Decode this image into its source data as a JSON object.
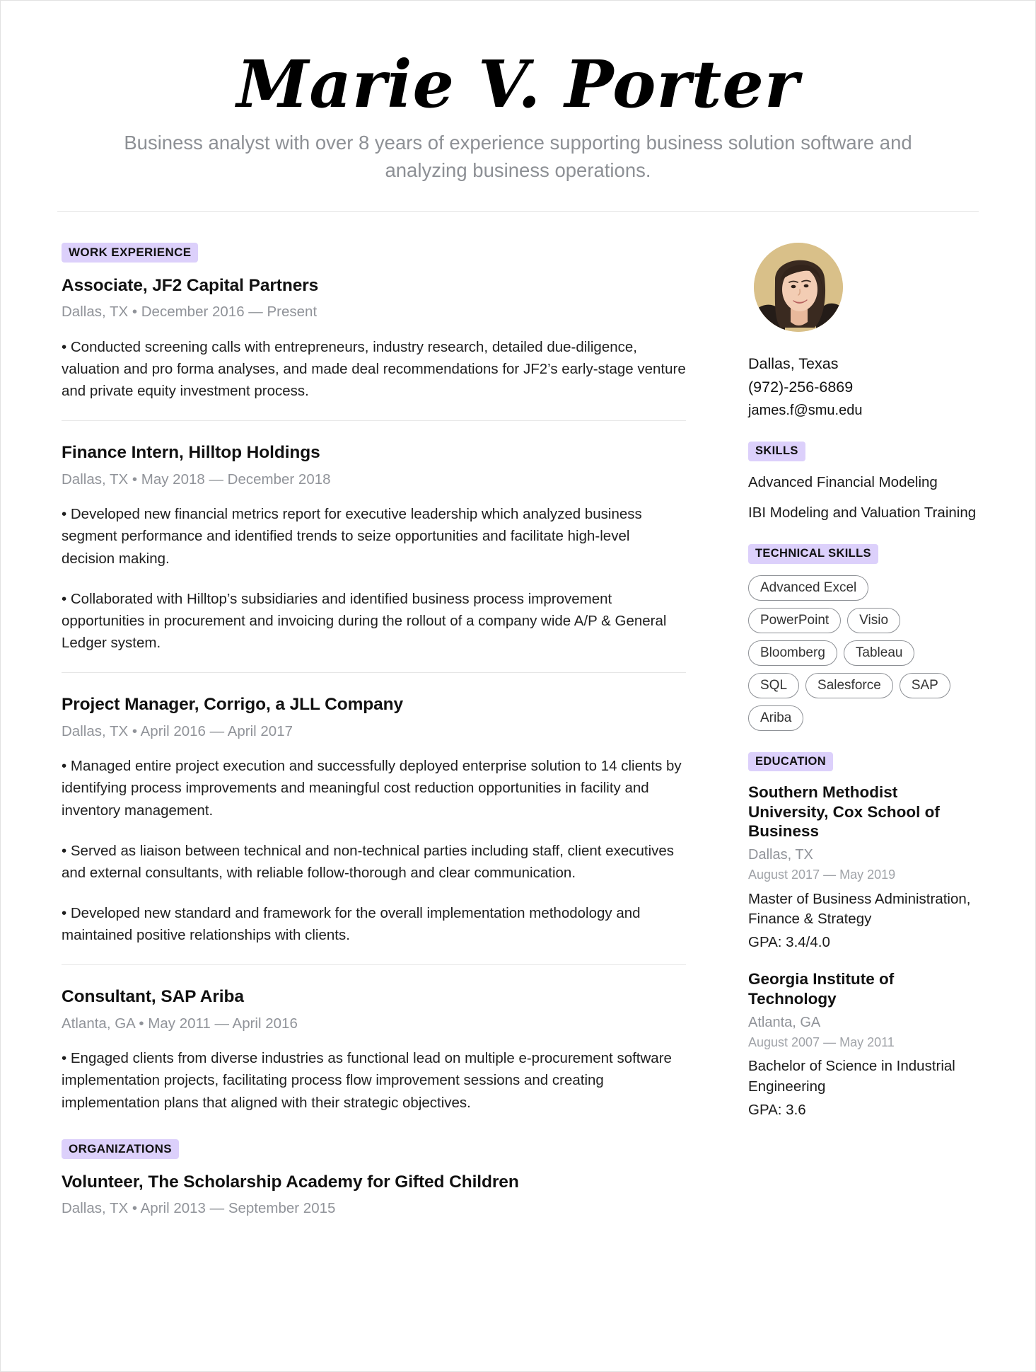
{
  "theme": {
    "badge_bg": "#dcd0fb",
    "muted_text": "#909399",
    "body_text": "#1f1f1f",
    "pill_border": "#8d9095",
    "avatar_bg": "#d9c089"
  },
  "header": {
    "name": "Marie V. Porter",
    "summary": "Business analyst with over 8 years of experience supporting business solution software and analyzing business operations."
  },
  "sections": {
    "work_experience_label": "WORK EXPERIENCE",
    "organizations_label": "ORGANIZATIONS",
    "skills_label": "SKILLS",
    "technical_skills_label": "TECHNICAL SKILLS",
    "education_label": "EDUCATION"
  },
  "work_experience": [
    {
      "title": "Associate, JF2 Capital Partners",
      "meta": "Dallas, TX • December 2016 — Present",
      "bullets": [
        "• Conducted screening calls with entrepreneurs, industry research, detailed due-diligence, valuation and pro forma analyses, and made deal recommendations for JF2’s early-stage venture and private equity investment process."
      ]
    },
    {
      "title": "Finance Intern, Hilltop Holdings",
      "meta": "Dallas, TX • May 2018 — December 2018",
      "bullets": [
        "• Developed new financial metrics report for executive leadership which analyzed business segment performance and identified trends to seize opportunities and facilitate high-level decision making.",
        "• Collaborated with Hilltop’s subsidiaries and identified business process improvement opportunities in procurement and invoicing during the rollout of a company wide A/P & General Ledger system."
      ]
    },
    {
      "title": "Project Manager, Corrigo, a JLL Company",
      "meta": "Dallas, TX • April 2016 — April 2017",
      "bullets": [
        "• Managed entire project execution and successfully deployed enterprise solution to 14 clients by identifying process improvements and meaningful cost reduction opportunities in facility and inventory management.",
        "• Served as liaison between technical and non-technical parties including staff, client executives and external consultants, with reliable follow-thorough and clear communication.",
        "• Developed new standard and framework for the overall implementation methodology and maintained positive relationships with clients."
      ]
    },
    {
      "title": "Consultant, SAP Ariba",
      "meta": "Atlanta, GA • May 2011 — April 2016",
      "bullets": [
        "• Engaged clients from diverse industries as functional lead on multiple e-procurement software implementation projects, facilitating process flow improvement sessions and creating implementation plans that aligned with their strategic objectives."
      ]
    }
  ],
  "organizations": [
    {
      "title": "Volunteer, The Scholarship Academy for Gifted Children",
      "meta": "Dallas, TX • April 2013 — September 2015",
      "bullets": []
    }
  ],
  "contact": {
    "location": "Dallas, Texas",
    "phone": "(972)-256-6869",
    "email": "james.f@smu.edu"
  },
  "skills": [
    "Advanced Financial Modeling",
    "IBI Modeling and Valuation Training"
  ],
  "technical_skills": [
    "Advanced Excel",
    "PowerPoint",
    "Visio",
    "Bloomberg",
    "Tableau",
    "SQL",
    "Salesforce",
    "SAP",
    "Ariba"
  ],
  "education": [
    {
      "school": "Southern Methodist University, Cox School of Business",
      "location": "Dallas, TX",
      "dates": "August 2017 — May 2019",
      "degree": "Master of Business Administration, Finance & Strategy",
      "gpa": "GPA: 3.4/4.0"
    },
    {
      "school": "Georgia Institute of Technology",
      "location": "Atlanta, GA",
      "dates": "August 2007 — May 2011",
      "degree": "Bachelor of Science in Industrial Engineering",
      "gpa": "GPA: 3.6"
    }
  ]
}
